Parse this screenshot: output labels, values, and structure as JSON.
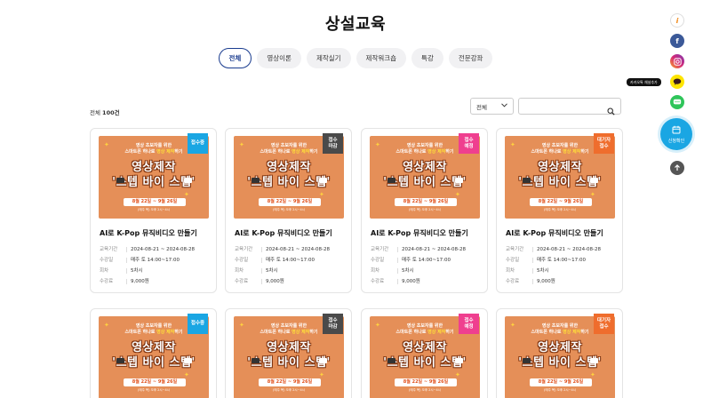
{
  "page": {
    "title": "상설교육"
  },
  "tabs": [
    {
      "label": "전체",
      "active": true
    },
    {
      "label": "영상이론",
      "active": false
    },
    {
      "label": "제작실기",
      "active": false
    },
    {
      "label": "제작워크숍",
      "active": false
    },
    {
      "label": "특강",
      "active": false
    },
    {
      "label": "전문강좌",
      "active": false
    }
  ],
  "list": {
    "total_prefix": "전체",
    "total_count": "100건"
  },
  "filter": {
    "selected": "전체",
    "search_placeholder": ""
  },
  "poster": {
    "line1": "영상 초보자를 위한",
    "line2a": "스마트폰 하나로 ",
    "line2b": "영상 제작",
    "line2c": "하기",
    "title1": "영상제작",
    "title2": "'스텝 바이 스텝'",
    "dates": "8월 22일 ~ 9월 26일",
    "time": "(매주 목) 오후 2시~4시",
    "bg_color": "#e58f58"
  },
  "labels": {
    "period": "교육기간",
    "schedule": "수강일",
    "sessions": "회차",
    "fee": "수강료"
  },
  "courses": [
    {
      "badge": "접수중",
      "status": "open",
      "title": "AI로 K-Pop 뮤직비디오 만들기",
      "period": "2024-08-21 ~ 2024-08-28",
      "schedule": "매주 토 14:00~17:00",
      "sessions": "5차시",
      "fee": "9,000원"
    },
    {
      "badge": "접수\n마감",
      "status": "closed",
      "title": "AI로 K-Pop 뮤직비디오 만들기",
      "period": "2024-08-21 ~ 2024-08-28",
      "schedule": "매주 토 14:00~17:00",
      "sessions": "5차시",
      "fee": "9,000원"
    },
    {
      "badge": "접수\n예정",
      "status": "soon",
      "title": "AI로 K-Pop 뮤직비디오 만들기",
      "period": "2024-08-21 ~ 2024-08-28",
      "schedule": "매주 토 14:00~17:00",
      "sessions": "5차시",
      "fee": "9,000원"
    },
    {
      "badge": "대기자\n접수",
      "status": "wait",
      "title": "AI로 K-Pop 뮤직비디오 만들기",
      "period": "2024-08-21 ~ 2024-08-28",
      "schedule": "매주 토 14:00~17:00",
      "sessions": "5차시",
      "fee": "9,000원"
    },
    {
      "badge": "접수중",
      "status": "open"
    },
    {
      "badge": "접수\n마감",
      "status": "closed"
    },
    {
      "badge": "접수\n예정",
      "status": "soon"
    },
    {
      "badge": "대기자\n접수",
      "status": "wait"
    }
  ],
  "sidebar": {
    "kakao_tip": "카카오톡 채널추가",
    "apply_label": "신청확인",
    "icons": [
      "info-icon",
      "facebook-icon",
      "instagram-icon",
      "kakaotalk-icon",
      "line-chat-icon",
      "calendar-icon",
      "arrow-up-icon"
    ],
    "colors": {
      "facebook": "#3b5998",
      "instagram": "#d62976",
      "kakao": "#fee500",
      "line": "#2fc55a",
      "apply": "#1aa6e3"
    }
  }
}
